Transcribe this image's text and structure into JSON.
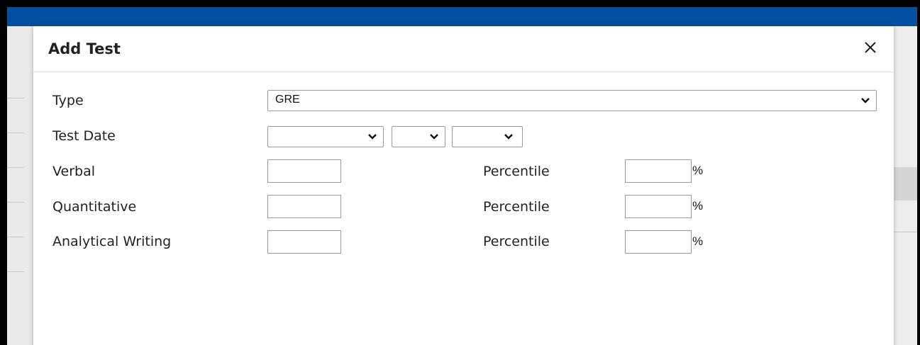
{
  "dialog": {
    "title": "Add Test",
    "close_icon": "close-icon"
  },
  "form": {
    "type_label": "Type",
    "type_value": "GRE",
    "test_date_label": "Test Date",
    "test_date": {
      "month_value": "",
      "day_value": "",
      "year_value": ""
    },
    "scores": [
      {
        "label": "Verbal",
        "value": "",
        "percentile_label": "Percentile",
        "percentile_value": "",
        "percent_sign": "%"
      },
      {
        "label": "Quantitative",
        "value": "",
        "percentile_label": "Percentile",
        "percentile_value": "",
        "percent_sign": "%"
      },
      {
        "label": "Analytical Writing",
        "value": "",
        "percentile_label": "Percentile",
        "percentile_value": "",
        "percent_sign": "%"
      }
    ]
  },
  "colors": {
    "top_bar": "#064ea0",
    "border": "#9a9a9a"
  }
}
